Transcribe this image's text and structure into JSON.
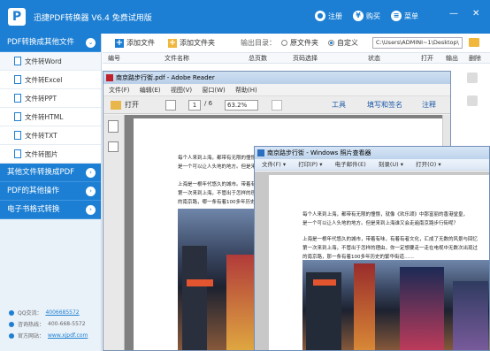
{
  "app": {
    "title": "迅捷PDF转换器 V6.4 免费试用版",
    "logo": "P",
    "actions": [
      {
        "label": "注册",
        "icon": "user-icon"
      },
      {
        "label": "购买",
        "icon": "yen-icon"
      },
      {
        "label": "菜单",
        "icon": "menu-icon"
      }
    ],
    "window_controls": [
      "—",
      "✕"
    ]
  },
  "sidebar": {
    "categories": [
      {
        "label": "PDF转换成其他文件",
        "expanded": true,
        "items": [
          "文件转Word",
          "文件转Excel",
          "文件转PPT",
          "文件转HTML",
          "文件转TXT",
          "文件转图片"
        ]
      },
      {
        "label": "其他文件转换成PDF",
        "expanded": false
      },
      {
        "label": "PDF的其他操作",
        "expanded": false
      },
      {
        "label": "电子书格式转换",
        "expanded": false
      }
    ],
    "contact": [
      {
        "label": "QQ交流：",
        "value": "4006685572"
      },
      {
        "label": "咨询热线：",
        "value": "400-668-5572"
      },
      {
        "label": "官方网站：",
        "value": "www.xjpdf.com"
      }
    ]
  },
  "toolbar": {
    "add_file": "添加文件",
    "add_folder": "添加文件夹",
    "output_label": "输出目录：",
    "option_original": "原文件夹",
    "option_custom": "自定义",
    "output_path": "C:\\Users\\ADMINI~1\\Desktop\\"
  },
  "table": {
    "headers": [
      "编号",
      "文件名称",
      "总页数",
      "页码选择",
      "状态",
      "打开",
      "输出",
      "删除"
    ]
  },
  "reader": {
    "title": "南京路步行街.pdf - Adobe Reader",
    "menu": [
      "文件(F)",
      "编辑(E)",
      "视图(V)",
      "窗口(W)",
      "帮助(H)"
    ],
    "open_label": "打开",
    "page": "1",
    "page_total": "/ 6",
    "zoom": "63.2%",
    "tools": [
      "工具",
      "填写和签名",
      "注释"
    ],
    "paragraphs": [
      "每个人来到上海，都带有无限的憧憬，就像《欢乐颂》中那富丽的香港堂皇，",
      "是一个可以让人头地的地方。但是来到上海谁又会走遍南京路",
      "上海是一根年代悠久的城市。带着有味，有着有者文化，",
      "第一次来到上海，不管出于怎样的理由，",
      "的南京路，哪一条有着100多年历史的"
    ]
  },
  "viewer": {
    "title": "南京路步行街 - Windows 照片查看器",
    "menu": [
      "文件(F) ▾",
      "打印(P) ▾",
      "电子邮件(E)",
      "刻录(U) ▾",
      "打开(O) ▾"
    ],
    "paragraphs": [
      "每个人来到上海，都带有无限的憧憬，就像《欢乐颂》中那富丽的香港堂皇，",
      "是一个可以让人头地的地方。但是来到上海谁又会走遍南京路步行街呢？",
      "上海是一根年代悠久的城市，带着有味，有着有者文化，汇成了无数的风景与回忆",
      "第一次来到上海，不管出于怎样的理由，你一定想要走一走在电视中无数次出现过",
      "的南京路，那一条有着100多年历史的繁华街道……"
    ]
  },
  "colors": {
    "primary": "#1d7fd3",
    "sidebar_bg": "#e9f1f9",
    "reader_gray": "#808080"
  }
}
